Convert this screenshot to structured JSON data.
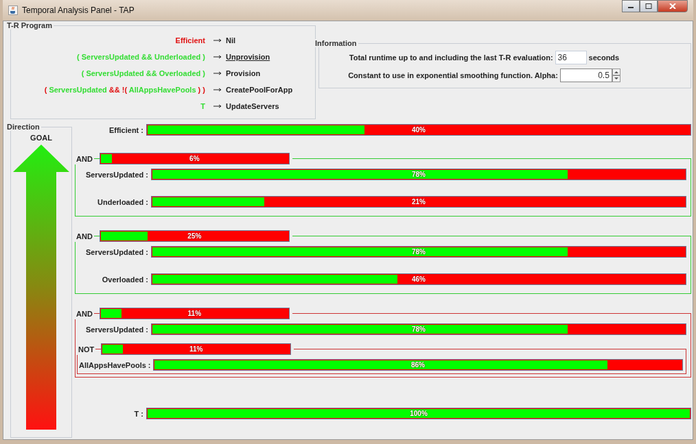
{
  "window": {
    "title": "Temporal Analysis Panel - TAP"
  },
  "program": {
    "title": "T-R Program",
    "rules": [
      {
        "condition": [
          {
            "text": "Efficient",
            "color": "#e01010"
          }
        ],
        "action": "Nil",
        "selected": false
      },
      {
        "condition": [
          {
            "text": "( ServersUpdated && Underloaded )",
            "color": "#33dd33"
          }
        ],
        "action": "Unprovision",
        "selected": true
      },
      {
        "condition": [
          {
            "text": "( ServersUpdated && Overloaded )",
            "color": "#33dd33"
          }
        ],
        "action": "Provision",
        "selected": false
      },
      {
        "condition": [
          {
            "text": "( ",
            "color": "#e01010"
          },
          {
            "text": "ServersUpdated",
            "color": "#33dd33"
          },
          {
            "text": " && !( ",
            "color": "#e01010"
          },
          {
            "text": "AllAppsHavePools",
            "color": "#33dd33"
          },
          {
            "text": " ) )",
            "color": "#e01010"
          }
        ],
        "action": "CreatePoolForApp",
        "selected": false
      },
      {
        "condition": [
          {
            "text": "T",
            "color": "#33dd33"
          }
        ],
        "action": "UpdateServers",
        "selected": false
      }
    ]
  },
  "information": {
    "title": "Information",
    "runtime_label": "Total runtime up to and including the last T-R evaluation:",
    "runtime_value": "36",
    "runtime_unit": "seconds",
    "alpha_label": "Constant to use in exponential smoothing function. Alpha:",
    "alpha_value": "0.5"
  },
  "direction": {
    "title": "Direction",
    "label": "GOAL"
  },
  "rows": [
    {
      "kind": "bar",
      "label": "Efficient :",
      "level": 0.4,
      "reading": "40%"
    },
    {
      "kind": "group",
      "operator": "AND",
      "color": "#33cc33",
      "level": 0.06,
      "reading": "6%",
      "children": [
        {
          "kind": "bar",
          "label": "ServersUpdated :",
          "level": 0.78,
          "reading": "78%"
        },
        {
          "kind": "bar",
          "label": "Underloaded :",
          "level": 0.21,
          "reading": "21%"
        }
      ]
    },
    {
      "kind": "group",
      "operator": "AND",
      "color": "#33cc33",
      "level": 0.25,
      "reading": "25%",
      "children": [
        {
          "kind": "bar",
          "label": "ServersUpdated :",
          "level": 0.78,
          "reading": "78%"
        },
        {
          "kind": "bar",
          "label": "Overloaded :",
          "level": 0.46,
          "reading": "46%"
        }
      ]
    },
    {
      "kind": "group",
      "operator": "AND",
      "color": "#cc3333",
      "level": 0.11,
      "reading": "11%",
      "children": [
        {
          "kind": "bar",
          "label": "ServersUpdated :",
          "level": 0.78,
          "reading": "78%"
        },
        {
          "kind": "group",
          "operator": "NOT",
          "color": "#cc3333",
          "level": 0.11,
          "reading": "11%",
          "children": [
            {
              "kind": "bar",
              "label": "AllAppsHavePools :",
              "level": 0.86,
              "reading": "86%"
            }
          ]
        }
      ]
    },
    {
      "kind": "bar",
      "label": "T :",
      "level": 1,
      "reading": "100%"
    }
  ]
}
